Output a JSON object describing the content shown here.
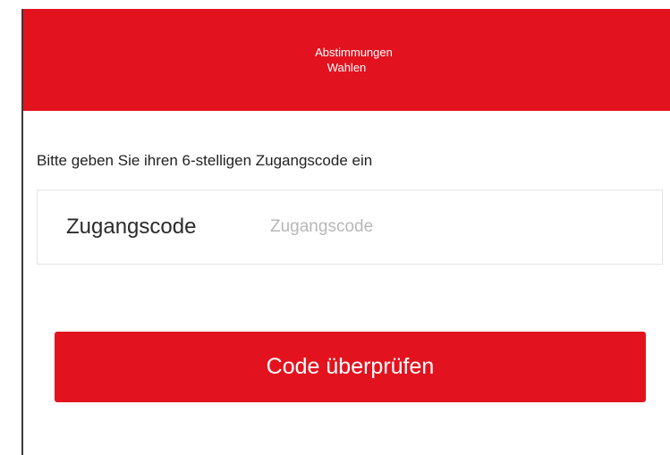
{
  "header": {
    "line1": "Abstimmungen",
    "line2": "Wahlen"
  },
  "form": {
    "prompt": "Bitte geben Sie ihren 6-stelligen Zugangscode ein",
    "field_label": "Zugangscode",
    "field_placeholder": "Zugangscode",
    "field_value": ""
  },
  "actions": {
    "submit_label": "Code überprüfen"
  },
  "colors": {
    "brand_red": "#e2131f",
    "text_dark": "#222222",
    "placeholder_gray": "#b7b7b7"
  }
}
